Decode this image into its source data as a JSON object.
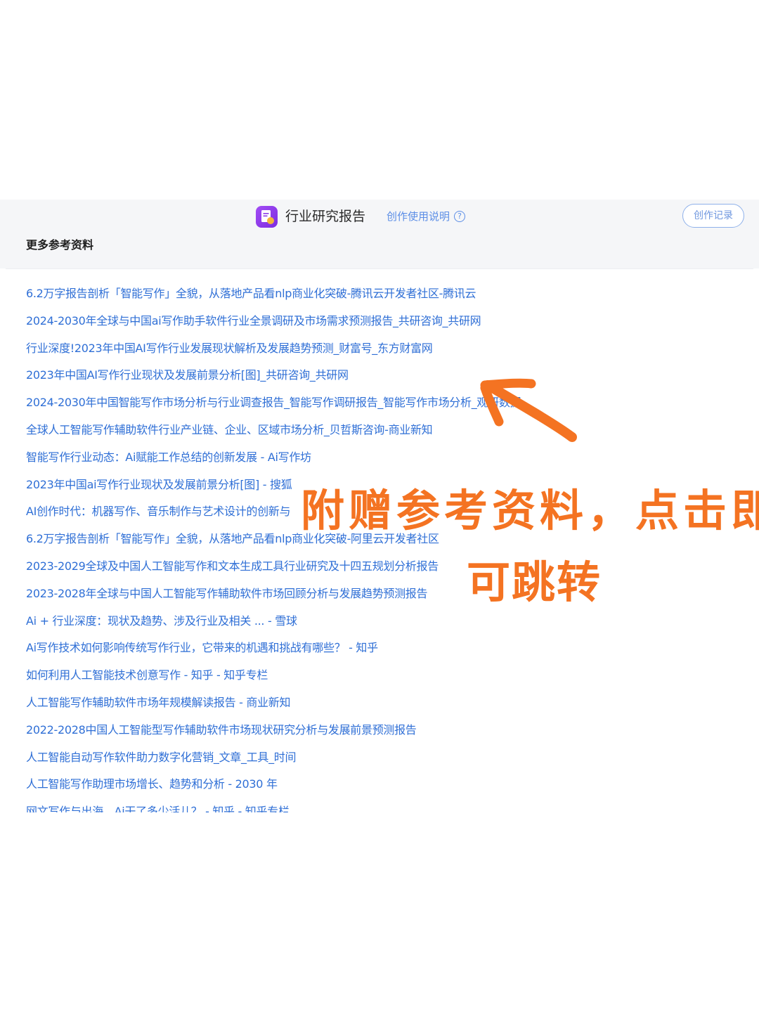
{
  "header": {
    "app_icon": "document-report-icon",
    "title": "行业研究报告",
    "help_link": "创作使用说明",
    "help_icon": "question-circle-icon",
    "history_button": "创作记录"
  },
  "section": {
    "title": "更多参考资料"
  },
  "references": [
    "6.2万字报告剖析「智能写作」全貌，从落地产品看nlp商业化突破-腾讯云开发者社区-腾讯云",
    "2024-2030年全球与中国ai写作助手软件行业全景调研及市场需求预测报告_共研咨询_共研网",
    "行业深度!2023年中国AI写作行业发展现状解析及发展趋势预测_财富号_东方财富网",
    "2023年中国AI写作行业现状及发展前景分析[图]_共研咨询_共研网",
    "2024-2030年中国智能写作市场分析与行业调查报告_智能写作调研报告_智能写作市场分析_观研数据",
    "全球人工智能写作辅助软件行业产业链、企业、区域市场分析_贝哲斯咨询-商业新知",
    "智能写作行业动态：Ai赋能工作总结的创新发展 - Ai写作坊",
    "2023年中国ai写作行业现状及发展前景分析[图] - 搜狐",
    "AI创作时代：机器写作、音乐制作与艺术设计的创新与",
    "6.2万字报告剖析「智能写作」全貌，从落地产品看nlp商业化突破-阿里云开发者社区",
    "2023-2029全球及中国人工智能写作和文本生成工具行业研究及十四五规划分析报告",
    "2023-2028年全球与中国人工智能写作辅助软件市场回顾分析与发展趋势预测报告",
    "Ai + 行业深度：现状及趋势、涉及行业及相关 ... - 雪球",
    "Ai写作技术如何影响传统写作行业，它带来的机遇和挑战有哪些？ - 知乎",
    "如何利用人工智能技术创意写作 - 知乎 - 知乎专栏",
    "人工智能写作辅助软件市场年规模解读报告 - 商业新知",
    "2022-2028中国人工智能型写作辅助软件市场现状研究分析与发展前景预测报告",
    "人工智能自动写作软件助力数字化营销_文章_工具_时间",
    "人工智能写作助理市场增长、趋势和分析 - 2030 年",
    "网文写作与出海，Ai干了多少活儿？ - 知乎 - 知乎专栏"
  ],
  "annotation": {
    "line1": "附赠参考资料，点击即",
    "line2": "可跳转",
    "arrow_icon": "hand-drawn-arrow-icon",
    "color": "#f47322"
  },
  "colors": {
    "link": "#2f6fd6",
    "accent": "#7d2de0",
    "header_bg": "#f5f6f8"
  }
}
